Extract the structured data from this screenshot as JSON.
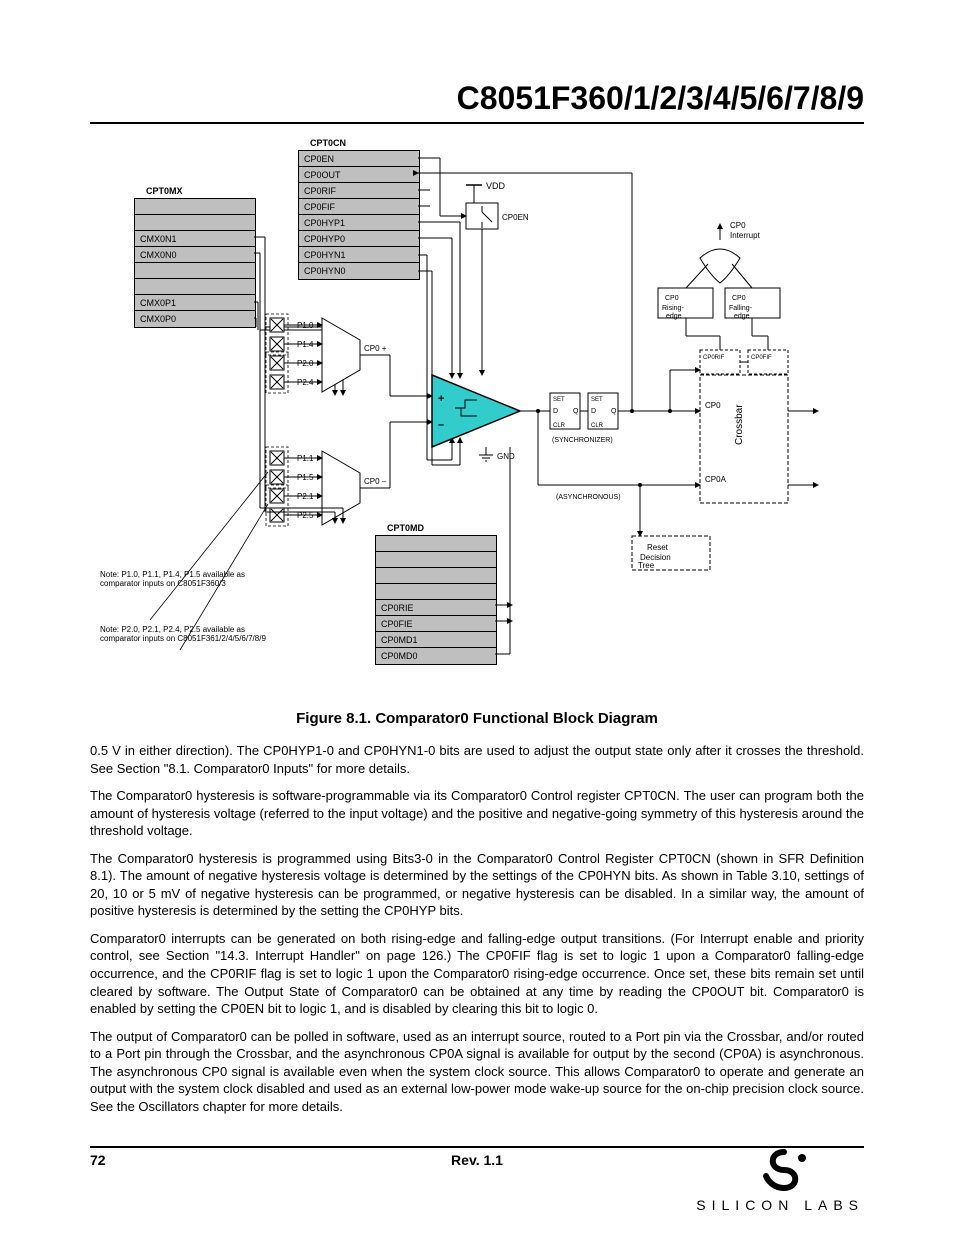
{
  "header": {
    "chip": "C8051F360/1/2/3/4/5/6/7/8/9"
  },
  "figure": {
    "caption": "Figure 8.1. Comparator0 Functional Block Diagram"
  },
  "footer": {
    "page": "72",
    "rev": "Rev. 1.1",
    "brand": "SILICON LABS"
  },
  "narr": {
    "p1": "0.5 V in either direction). The CP0HYP1-0 and CP0HYN1-0 bits are used to adjust the output state only after it crosses the threshold. See",
    "p1b": "Section \"8.1. Comparator0 Inputs\" for more details.",
    "p2": "The Comparator0 hysteresis is software-programmable via its Comparator0 Control register CPT0CN.",
    "p3": "The user can program both the amount of hysteresis voltage (referred to the input voltage) and the positive and negative-going symmetry of this hysteresis around the threshold voltage.",
    "p4": "The Comparator0 hysteresis is programmed using Bits3-0 in the Comparator0 Control Register CPT0CN (shown in ",
    "p4b": "SFR Definition 8.1",
    "p4c": "). The amount of negative hysteresis voltage is determined by the settings of the CP0HYN bits. As shown in ",
    "p4d": "Table 3.10",
    "p4e": ", settings of 20, 10 or 5 mV of negative hysteresis can be programmed, or negative hysteresis can be disabled. In a similar way, the amount of positive hysteresis is determined by the setting the CP0HYP bits.",
    "p5": "Comparator0 interrupts can be generated on both rising-edge and falling-edge output transitions. (For Interrupt enable and priority control, see ",
    "p5b": "Section \"14.3. Interrupt Handler\" on page 126",
    "p5c": ".) The CP0FIF flag is set to logic 1 upon a Comparator0 falling-edge occurrence, and the CP0RIF flag is set to logic 1 upon the Comparator0 rising-edge occurrence. Once set, these bits remain set until cleared by software. The Output State of Comparator0 can be obtained at any time by reading the CP0OUT bit. Comparator0 is enabled by setting the CP0EN bit to logic 1, and is disabled by clearing this bit to logic 0.",
    "p6": "The output of Comparator0 can be polled in software, used as an interrupt source, routed to a Port pin via the Crossbar, and/or routed to a Port pin through the Crossbar, and the asynchronous CP0A signal is available for output by the second (CP0A) is asynchronous. The asynchronous CP0 signal is available even when the system clock source. This allows Comparator0 to operate and generate an output with the system clock disabled and used as an external low-power mode wake-up source for the on-chip precision clock source. See the Oscillators chapter for more details."
  },
  "diagram": {
    "cpt0mx": {
      "name": "CPT0MX",
      "bits": [
        "",
        "",
        "CMX0N1",
        "CMX0N0",
        "",
        "",
        "CMX0P1",
        "CMX0P0"
      ]
    },
    "cpt0cn": {
      "name": "CPT0CN",
      "bits": [
        "CP0EN",
        "CP0OUT",
        "CP0RIF",
        "CP0FIF",
        "CP0HYP1",
        "CP0HYP0",
        "CP0HYN1",
        "CP0HYN0"
      ]
    },
    "cpt0md": {
      "name": "CPT0MD",
      "bits": [
        "",
        "",
        "",
        "",
        "CP0RIE",
        "CP0FIE",
        "CP0MD1",
        "CP0MD0"
      ]
    },
    "pins_p": [
      "P1.0",
      "P1.4",
      "P2.0",
      "P2.4"
    ],
    "pins_n": [
      "P1.1",
      "P1.5",
      "P2.1",
      "P2.5"
    ],
    "mux_p": "CP0 +   ",
    "mux_n": "CP0 –",
    "note_mux": "Note: P1.0, P1.1, P1.4, P1.5 available as comparator inputs on C8051F360/3",
    "note_mux2": "Note: P2.0, P2.1, P2.4, P2.5 available as comparator inputs on C8051F361/2/4/5/6/7/8/9",
    "vdd": "VDD",
    "gnd": "GND",
    "set": "SET",
    "clr": "CLR",
    "d": "D",
    "q": "Q",
    "reset": "Reset Decision Tree",
    "interrupt": "CP0 Interrupt",
    "crossbar": "Crossbar",
    "re": "CP0RIF",
    "fe": "CP0FIF",
    "sync_out": "(SYNCHRONIZER)",
    "async": "(ASYNCHRONOUS)",
    "cp0": "CP0",
    "cp0a": "CP0A",
    "cp0en_lbl": "CP0EN",
    "rising": "CP0 Rising-edge",
    "falling": "CP0 Falling-edge"
  }
}
